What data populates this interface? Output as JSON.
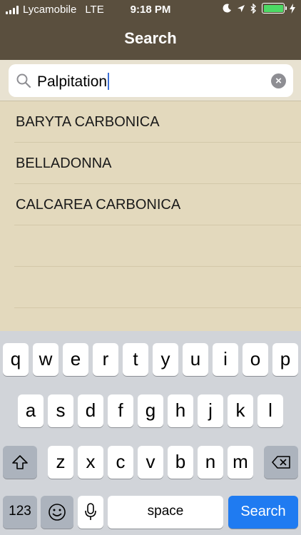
{
  "status_bar": {
    "carrier": "Lycamobile",
    "network": "LTE",
    "time": "9:18 PM",
    "battery_level": 1.0,
    "icons": [
      "moon-icon",
      "location-arrow-icon",
      "bluetooth-icon",
      "battery-icon",
      "charging-bolt-icon"
    ]
  },
  "nav": {
    "title": "Search"
  },
  "search": {
    "value": "Palpitation",
    "icon": "magnifier-icon",
    "clear_icon": "clear-icon"
  },
  "results": {
    "items": [
      {
        "label": "BARYTA CARBONICA"
      },
      {
        "label": "BELLADONNA"
      },
      {
        "label": "CALCAREA CARBONICA"
      },
      {
        "label": ""
      },
      {
        "label": ""
      }
    ]
  },
  "keyboard": {
    "row1": [
      "q",
      "w",
      "e",
      "r",
      "t",
      "y",
      "u",
      "i",
      "o",
      "p"
    ],
    "row2": [
      "a",
      "s",
      "d",
      "f",
      "g",
      "h",
      "j",
      "k",
      "l"
    ],
    "row3": [
      "z",
      "x",
      "c",
      "v",
      "b",
      "n",
      "m"
    ],
    "numbers_label": "123",
    "space_label": "space",
    "search_label": "Search",
    "icons": [
      "shift-icon",
      "backspace-icon",
      "emoji-icon",
      "microphone-icon"
    ]
  },
  "colors": {
    "nav_background": "#5a4f3e",
    "list_background": "#e3d9bd",
    "accent": "#1f7bf1",
    "battery": "#4cd964"
  }
}
